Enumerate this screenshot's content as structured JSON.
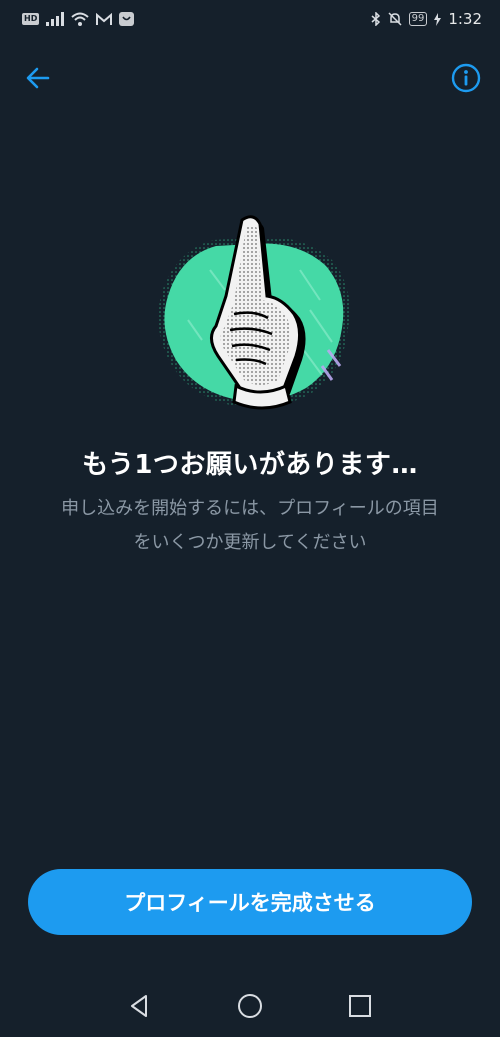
{
  "status_bar": {
    "hd_label": "HD",
    "battery": "99",
    "time": "1:32"
  },
  "icons": {
    "back": "arrow-left-icon",
    "info": "info-icon",
    "illustration": "pointing-hand-illustration",
    "nav_back": "triangle-back-icon",
    "nav_home": "circle-home-icon",
    "nav_recents": "square-recents-icon"
  },
  "colors": {
    "background": "#15202b",
    "accent": "#1d9bf0",
    "secondary_text": "#8b98a5",
    "illustration_green": "#45d9a6"
  },
  "main": {
    "title": "もう1つお願いがあります…",
    "description_line1": "申し込みを開始するには、プロフィールの項目",
    "description_line2": "をいくつか更新してください"
  },
  "cta": {
    "label": "プロフィールを完成させる"
  }
}
